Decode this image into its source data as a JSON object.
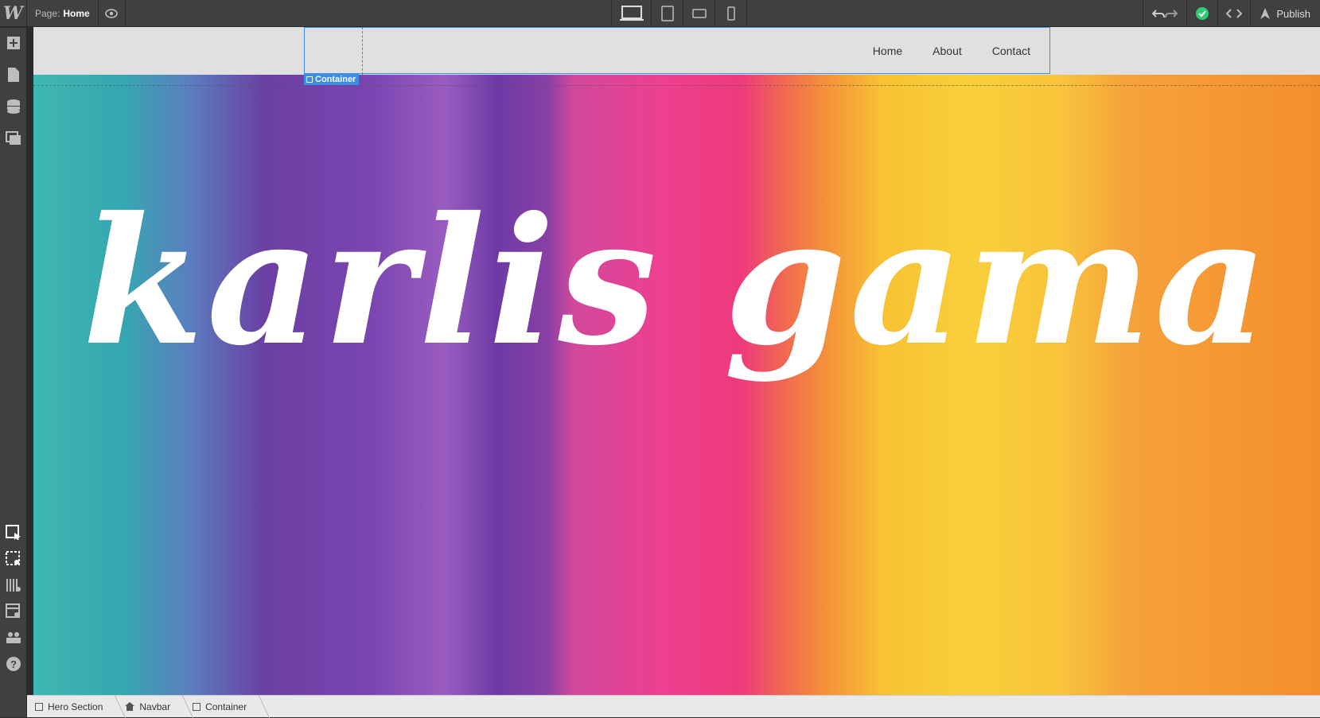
{
  "app": {
    "logo": "W",
    "page_label": "Page:",
    "page_name": "Home",
    "publish_label": "Publish",
    "status_color": "#2ecc71"
  },
  "devices": [
    "desktop-icon",
    "tablet-icon",
    "mobile-landscape-icon",
    "mobile-portrait-icon"
  ],
  "left_tools": [
    "add-icon",
    "pages-icon",
    "cms-icon",
    "assets-icon",
    "select-icon",
    "preview-box-icon",
    "grid-icon",
    "style-manager-icon",
    "users-icon",
    "help-icon"
  ],
  "canvas": {
    "nav_links": [
      "Home",
      "About",
      "Contact"
    ],
    "selection_tag": "Container",
    "hero_title": "karlis gama"
  },
  "breadcrumb": [
    {
      "label": "Hero Section",
      "icon": "section-icon"
    },
    {
      "label": "Navbar",
      "icon": "home-icon"
    },
    {
      "label": "Container",
      "icon": "container-icon"
    }
  ]
}
